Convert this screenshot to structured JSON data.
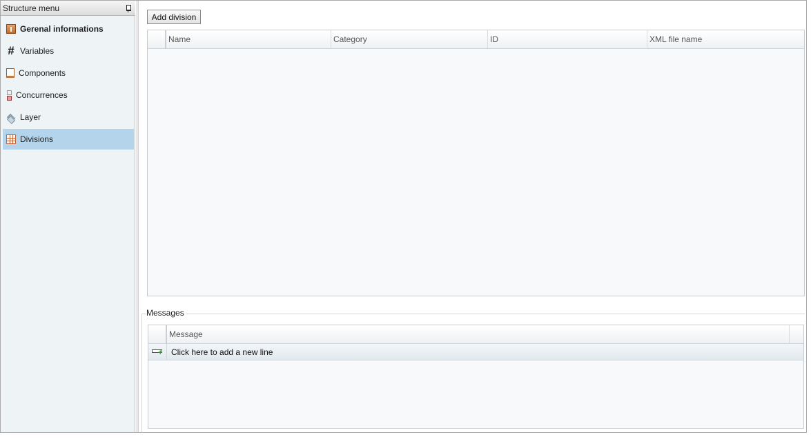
{
  "sidebar": {
    "title": "Structure menu",
    "items": [
      {
        "label": "Gerenal informations",
        "icon": "info-icon"
      },
      {
        "label": "Variables",
        "icon": "hash-icon"
      },
      {
        "label": "Components",
        "icon": "component-icon"
      },
      {
        "label": "Concurrences",
        "icon": "concurrence-icon"
      },
      {
        "label": "Layer",
        "icon": "layer-icon"
      },
      {
        "label": "Divisions",
        "icon": "grid-icon",
        "selected": true
      }
    ]
  },
  "toolbar": {
    "add_label": "Add division"
  },
  "divisions_grid": {
    "columns": [
      "Name",
      "Category",
      "ID",
      "XML file name"
    ],
    "rows": []
  },
  "messages": {
    "group_label": "Messages",
    "columns": [
      "Message"
    ],
    "new_line_label": "Click here to add a new line",
    "rows": []
  }
}
